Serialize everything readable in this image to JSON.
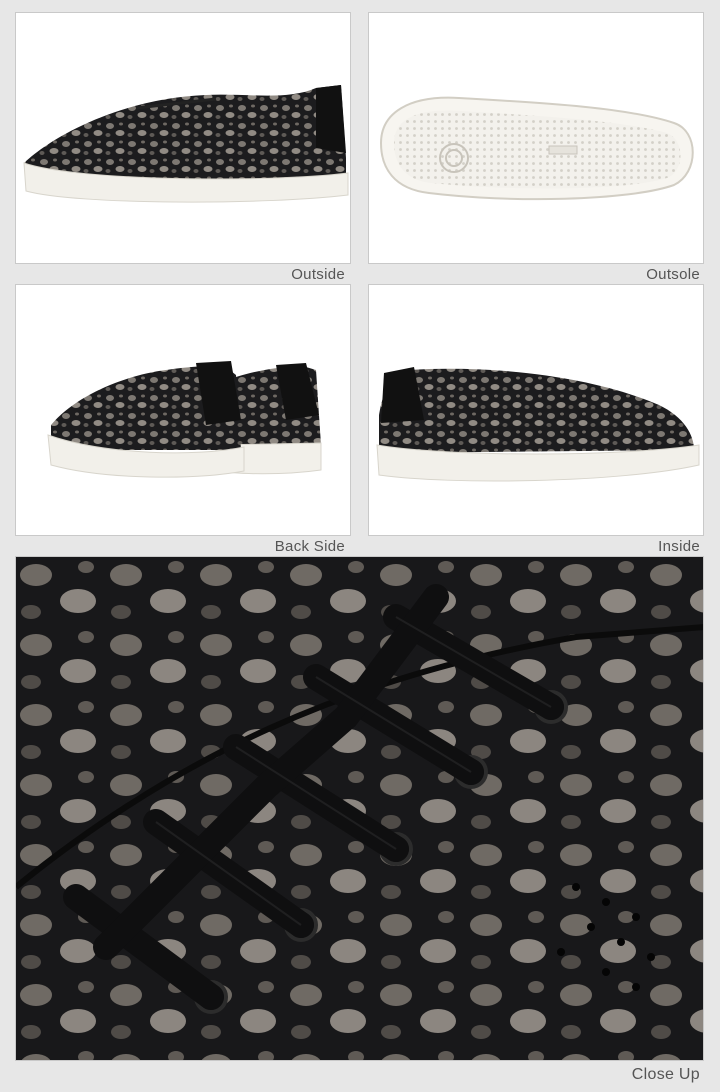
{
  "captions": {
    "outside": "Outside",
    "outsole": "Outsole",
    "back_side": "Back Side",
    "inside": "Inside",
    "close_up": "Close Up"
  },
  "colors": {
    "background": "#e7e7e7",
    "panel": "#ffffff",
    "upper": "#1c1c1e",
    "metallic": "#8a8580",
    "sole": "#f2f0ea"
  }
}
